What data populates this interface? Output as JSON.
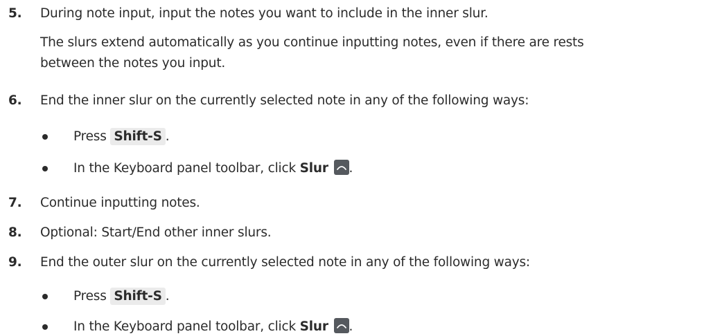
{
  "steps": [
    {
      "number": "5.",
      "text": "During note input, input the notes you want to include in the inner slur."
    },
    {
      "number": "6.",
      "text": "End the inner slur on the currently selected note in any of the following ways:"
    },
    {
      "number": "7.",
      "text": "Continue inputting notes."
    },
    {
      "number": "8.",
      "text": "Optional: Start/End other inner slurs."
    },
    {
      "number": "9.",
      "text": "End the outer slur on the currently selected note in any of the following ways:"
    }
  ],
  "step5_note": {
    "line1": "The slurs extend automatically as you continue inputting notes, even if there are rests",
    "line2": "between the notes you input."
  },
  "step6_options": {
    "press_prefix": "Press",
    "key": "Shift-S",
    "press_suffix": ".",
    "toolbar_prefix": "In the Keyboard panel toolbar, click",
    "toolbar_button": "Slur",
    "toolbar_suffix": "."
  },
  "step9_options": {
    "press_prefix": "Press",
    "key": "Shift-S",
    "press_suffix": ".",
    "toolbar_prefix": "In the Keyboard panel toolbar, click",
    "toolbar_button": "Slur",
    "toolbar_suffix": "."
  },
  "icons": {
    "slur": "slur-icon",
    "bullet": "bullet-icon"
  },
  "colors": {
    "text": "#2b2b2b",
    "key_background": "#ebebeb",
    "slur_icon_background": "#55595e"
  }
}
